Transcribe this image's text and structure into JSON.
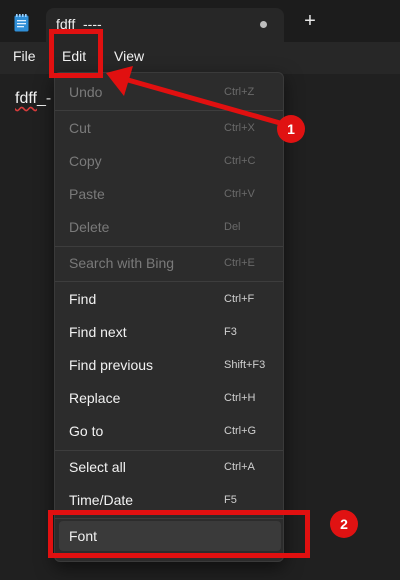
{
  "tab": {
    "title": "fdff_----",
    "new_tab": "+"
  },
  "menubar": {
    "file": "File",
    "edit": "Edit",
    "view": "View"
  },
  "editor": {
    "text_visible": "fdff_-",
    "spell_flagged": "fdff"
  },
  "edit_menu": {
    "items": [
      {
        "label": "Undo",
        "shortcut": "Ctrl+Z",
        "disabled": true
      },
      {
        "label": "Cut",
        "shortcut": "Ctrl+X",
        "disabled": true
      },
      {
        "label": "Copy",
        "shortcut": "Ctrl+C",
        "disabled": true
      },
      {
        "label": "Paste",
        "shortcut": "Ctrl+V",
        "disabled": true
      },
      {
        "label": "Delete",
        "shortcut": "Del",
        "disabled": true
      },
      {
        "label": "Search with Bing",
        "shortcut": "Ctrl+E",
        "disabled": true
      },
      {
        "label": "Find",
        "shortcut": "Ctrl+F",
        "disabled": false
      },
      {
        "label": "Find next",
        "shortcut": "F3",
        "disabled": false
      },
      {
        "label": "Find previous",
        "shortcut": "Shift+F3",
        "disabled": false
      },
      {
        "label": "Replace",
        "shortcut": "Ctrl+H",
        "disabled": false
      },
      {
        "label": "Go to",
        "shortcut": "Ctrl+G",
        "disabled": false
      },
      {
        "label": "Select all",
        "shortcut": "Ctrl+A",
        "disabled": false
      },
      {
        "label": "Time/Date",
        "shortcut": "F5",
        "disabled": false
      },
      {
        "label": "Font",
        "shortcut": "",
        "disabled": false,
        "highlighted": true
      }
    ]
  },
  "annotations": {
    "step1": "1",
    "step2": "2"
  },
  "colors": {
    "annotation_red": "#e11010",
    "background": "#202020",
    "menu_bg": "#2c2c2c"
  }
}
